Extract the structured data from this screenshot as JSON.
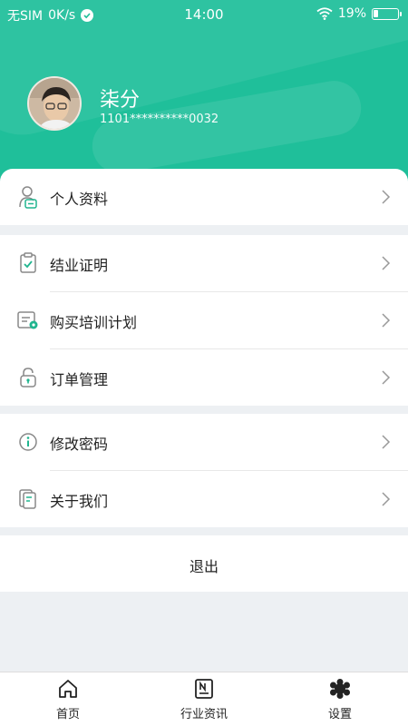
{
  "status_bar": {
    "carrier": "无SIM",
    "speed": "0K/s",
    "time": "14:00",
    "battery": "19%",
    "battery_level": 0.19
  },
  "profile": {
    "name": "柒分",
    "phone": "1101**********0032"
  },
  "menu_groups": [
    [
      {
        "label": "个人资料",
        "icon": "user-profile-icon"
      }
    ],
    [
      {
        "label": "结业证明",
        "icon": "clipboard-check-icon"
      },
      {
        "label": "购买培训计划",
        "icon": "plan-document-icon"
      },
      {
        "label": "订单管理",
        "icon": "lock-icon"
      }
    ],
    [
      {
        "label": "修改密码",
        "icon": "info-circle-icon"
      },
      {
        "label": "关于我们",
        "icon": "document-icon"
      }
    ]
  ],
  "logout_label": "退出",
  "tabs": [
    {
      "label": "首页",
      "icon": "home-icon"
    },
    {
      "label": "行业资讯",
      "icon": "news-icon"
    },
    {
      "label": "设置",
      "icon": "settings-icon",
      "active": true
    }
  ],
  "colors": {
    "accent": "#1fbf9a",
    "icon_green": "#20b58f"
  }
}
